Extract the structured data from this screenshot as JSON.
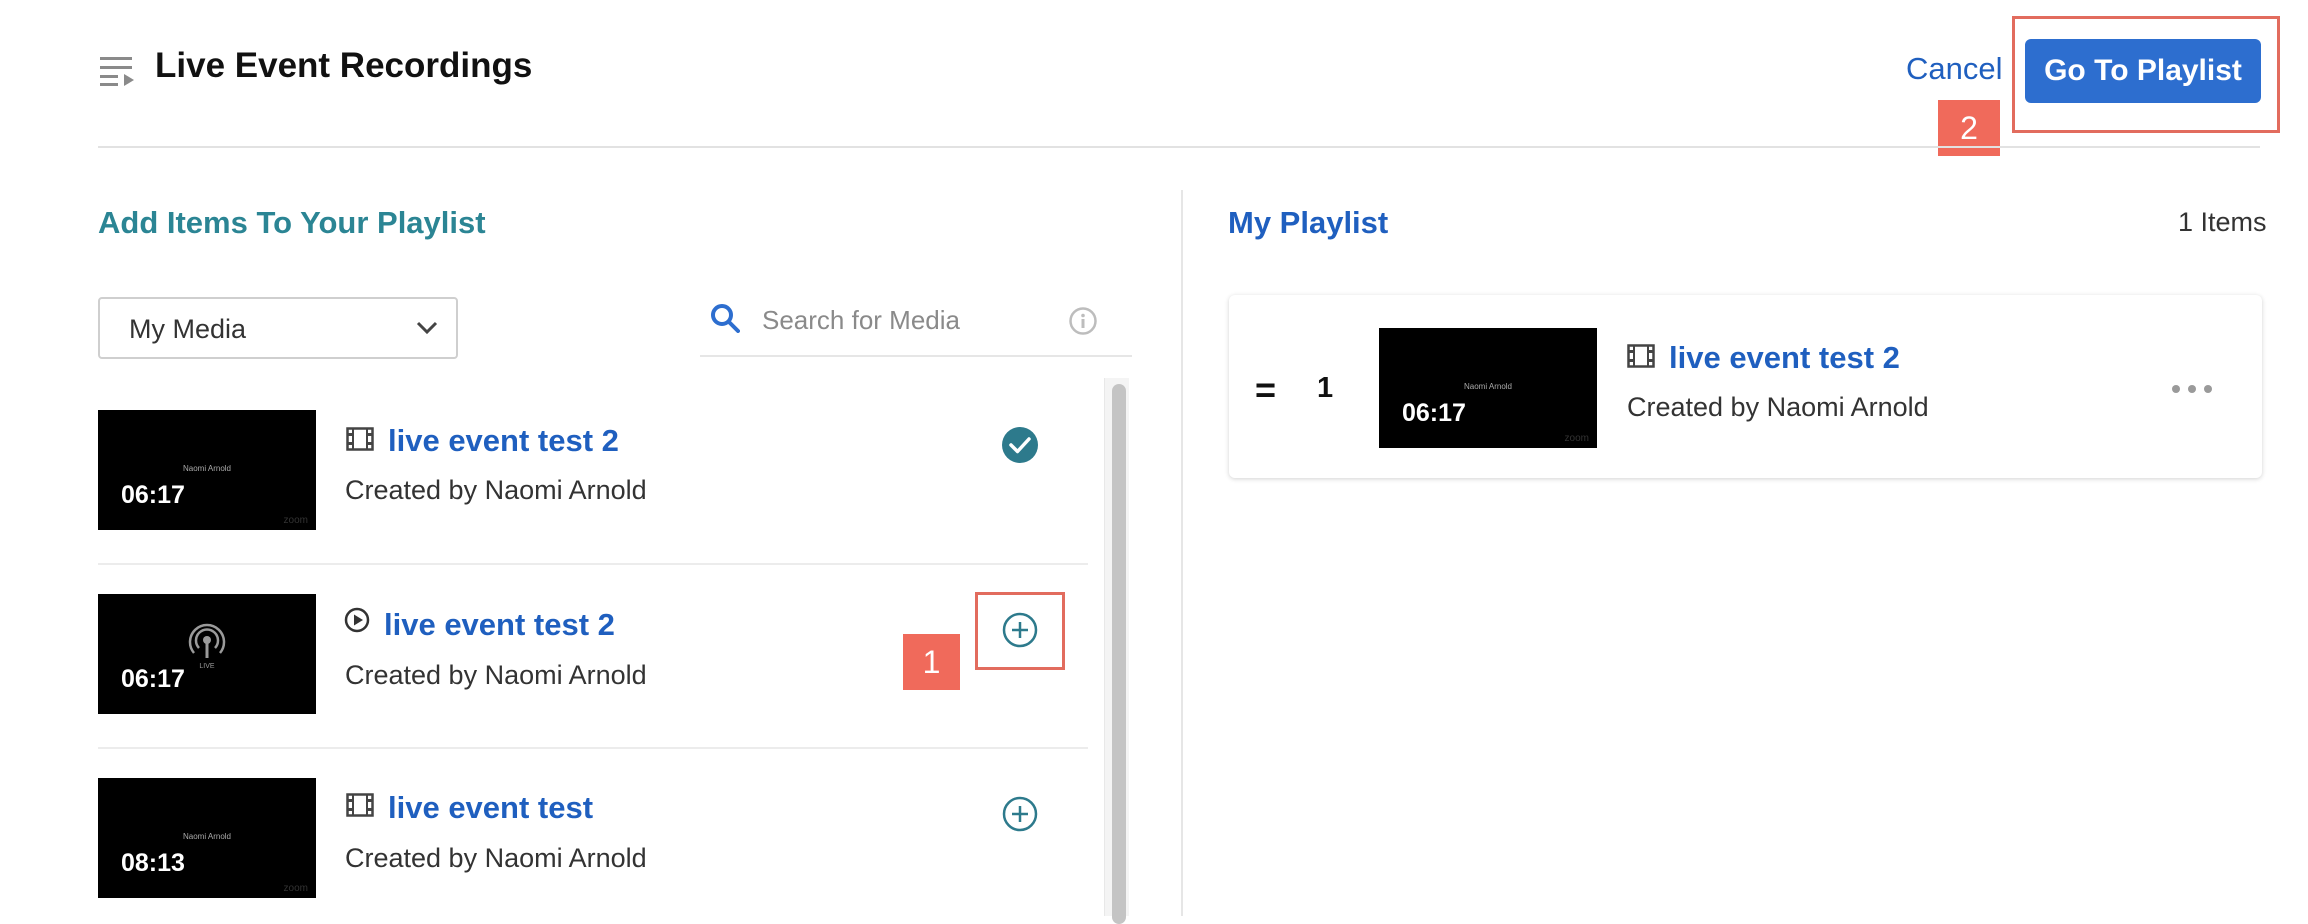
{
  "header": {
    "title": "Live Event Recordings",
    "cancel_label": "Cancel",
    "go_to_playlist_label": "Go To Playlist"
  },
  "annotations": {
    "step_1": "1",
    "step_2": "2",
    "highlight_color": "#e26c5e"
  },
  "left_panel": {
    "title": "Add Items To Your Playlist",
    "source_select": {
      "selected": "My Media"
    },
    "search": {
      "placeholder": "Search for Media"
    },
    "media_items": [
      {
        "title": "live event test 2",
        "creator": "Created by Naomi Arnold",
        "duration": "06:17",
        "type_icon": "film-icon",
        "status": "added",
        "status_icon": "check-circle-icon"
      },
      {
        "title": "live event test 2",
        "creator": "Created by Naomi Arnold",
        "duration": "06:17",
        "type_icon": "play-circle-icon",
        "status": "not-added",
        "status_icon": "add-circle-icon"
      },
      {
        "title": "live event test",
        "creator": "Created by Naomi Arnold",
        "duration": "08:13",
        "type_icon": "film-icon",
        "status": "not-added",
        "status_icon": "add-circle-icon"
      }
    ]
  },
  "right_panel": {
    "title": "My Playlist",
    "count_label": "1 Items",
    "items": [
      {
        "index": "1",
        "title": "live event test 2",
        "creator": "Created by Naomi Arnold",
        "duration": "06:17",
        "type_icon": "film-icon"
      }
    ]
  },
  "colors": {
    "brand_blue": "#2d6ecf",
    "link_blue": "#1f5fbf",
    "teal": "#2b8594",
    "badge": "#f06a5b"
  }
}
